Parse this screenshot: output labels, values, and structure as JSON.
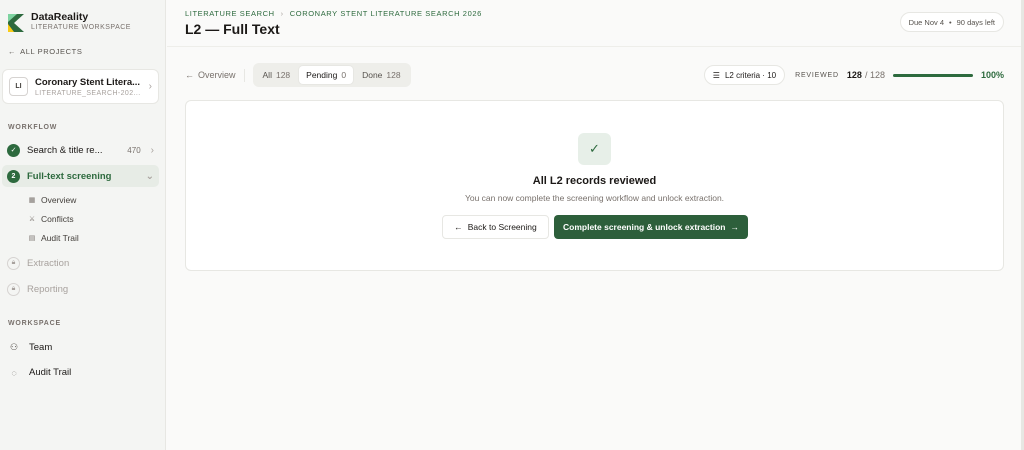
{
  "brand": {
    "name": "DataReality",
    "subtitle": "LITERATURE WORKSPACE"
  },
  "sidebar": {
    "all_projects": "ALL PROJECTS",
    "project": {
      "initials": "LI",
      "name": "Coronary Stent Litera...",
      "id": "LITERATURE_SEARCH-202..."
    },
    "workflow_label": "WORKFLOW",
    "steps": [
      {
        "marker": "✓",
        "label": "Search & title re...",
        "count": "470"
      },
      {
        "marker": "2",
        "label": "Full-text screening"
      },
      {
        "label": "Extraction"
      },
      {
        "label": "Reporting"
      }
    ],
    "sub_items": [
      {
        "label": "Overview"
      },
      {
        "label": "Conflicts"
      },
      {
        "label": "Audit Trail"
      }
    ],
    "workspace_label": "WORKSPACE",
    "workspace_items": [
      {
        "label": "Team"
      },
      {
        "label": "Audit Trail"
      }
    ]
  },
  "header": {
    "breadcrumb": [
      "LITERATURE SEARCH",
      "CORONARY STENT LITERATURE SEARCH 2026"
    ],
    "title": "L2 — Full Text",
    "due": "Due Nov 4",
    "days_left": "90 days left"
  },
  "toolbar": {
    "overview": "Overview",
    "tabs": [
      {
        "label": "All",
        "count": "128"
      },
      {
        "label": "Pending",
        "count": "0"
      },
      {
        "label": "Done",
        "count": "128"
      }
    ],
    "criteria": "L2 criteria · 10",
    "reviewed_label": "REVIEWED",
    "reviewed": "128",
    "total": "/ 128",
    "progress_fraction": 1.0,
    "progress_pct": "100%"
  },
  "card": {
    "title": "All L2 records reviewed",
    "subtitle": "You can now complete the screening workflow and unlock extraction.",
    "back_button": "Back to Screening",
    "complete_button": "Complete screening & unlock extraction"
  },
  "colors": {
    "accent": "#2d6a3e",
    "primary_button": "#2d5f3b"
  }
}
